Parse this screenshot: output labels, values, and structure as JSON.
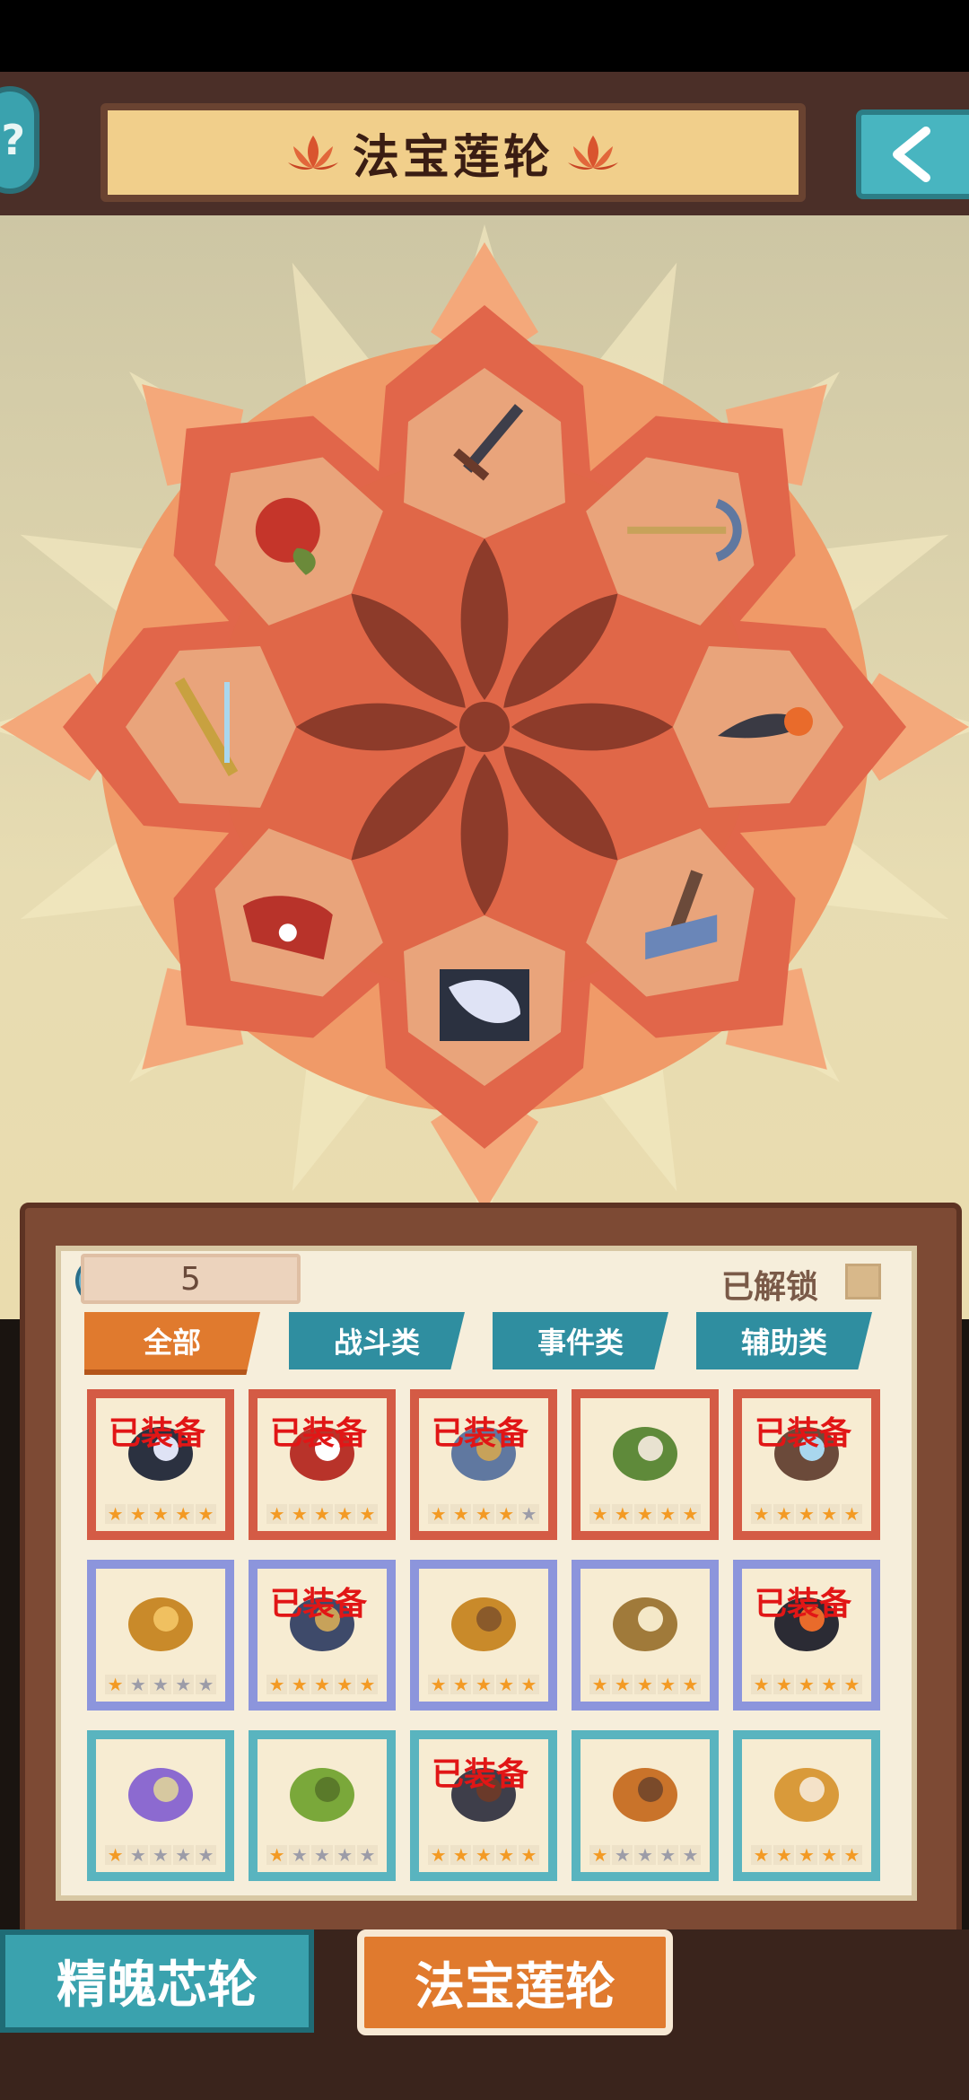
{
  "header": {
    "title": "法宝莲轮",
    "help_label": "?",
    "back_icon": "back-arrow-icon"
  },
  "wheel": {
    "items": [
      {
        "name": "sword-icon"
      },
      {
        "name": "trident-icon"
      },
      {
        "name": "fire-feather-icon"
      },
      {
        "name": "rake-icon"
      },
      {
        "name": "white-feather-icon"
      },
      {
        "name": "red-gourd-scroll-icon"
      },
      {
        "name": "lightning-rod-icon"
      },
      {
        "name": "peach-icon"
      }
    ]
  },
  "inventory": {
    "count": "5",
    "unlocked_label": "已解锁",
    "tabs": [
      {
        "label": "全部"
      },
      {
        "label": "战斗类"
      },
      {
        "label": "事件类"
      },
      {
        "label": "辅助类"
      }
    ],
    "equipped_label": "已装备",
    "items": [
      {
        "icon": "white-feather-icon",
        "equipped": true,
        "stars": 5,
        "rarity": "red"
      },
      {
        "icon": "red-scroll-icon",
        "equipped": true,
        "stars": 5,
        "rarity": "red"
      },
      {
        "icon": "trident-icon",
        "equipped": true,
        "stars": 4,
        "rarity": "red"
      },
      {
        "icon": "green-gourd-icon",
        "equipped": false,
        "stars": 5,
        "rarity": "red"
      },
      {
        "icon": "lightning-rod-icon",
        "equipped": true,
        "stars": 5,
        "rarity": "red"
      },
      {
        "icon": "bead-necklace-icon",
        "equipped": false,
        "stars": 1,
        "rarity": "blue"
      },
      {
        "icon": "spear-icon",
        "equipped": true,
        "stars": 5,
        "rarity": "blue"
      },
      {
        "icon": "vajra-icon",
        "equipped": false,
        "stars": 5,
        "rarity": "blue"
      },
      {
        "icon": "book-icon",
        "equipped": false,
        "stars": 5,
        "rarity": "blue"
      },
      {
        "icon": "fire-feather-icon",
        "equipped": true,
        "stars": 5,
        "rarity": "blue"
      },
      {
        "icon": "purple-orbs-icon",
        "equipped": false,
        "stars": 1,
        "rarity": "teal"
      },
      {
        "icon": "green-vine-icon",
        "equipped": false,
        "stars": 1,
        "rarity": "teal"
      },
      {
        "icon": "sword-icon",
        "equipped": true,
        "stars": 5,
        "rarity": "teal"
      },
      {
        "icon": "beads-ring-icon",
        "equipped": false,
        "stars": 1,
        "rarity": "teal"
      },
      {
        "icon": "golden-bell-icon",
        "equipped": false,
        "stars": 5,
        "rarity": "teal"
      }
    ]
  },
  "bottom_nav": {
    "left_label": "精魄芯轮",
    "right_label": "法宝莲轮"
  },
  "colors": {
    "accent_orange": "#e07a2e",
    "teal": "#2f8ea0",
    "equipped_red": "#e11616",
    "star_on": "#f39a24"
  }
}
